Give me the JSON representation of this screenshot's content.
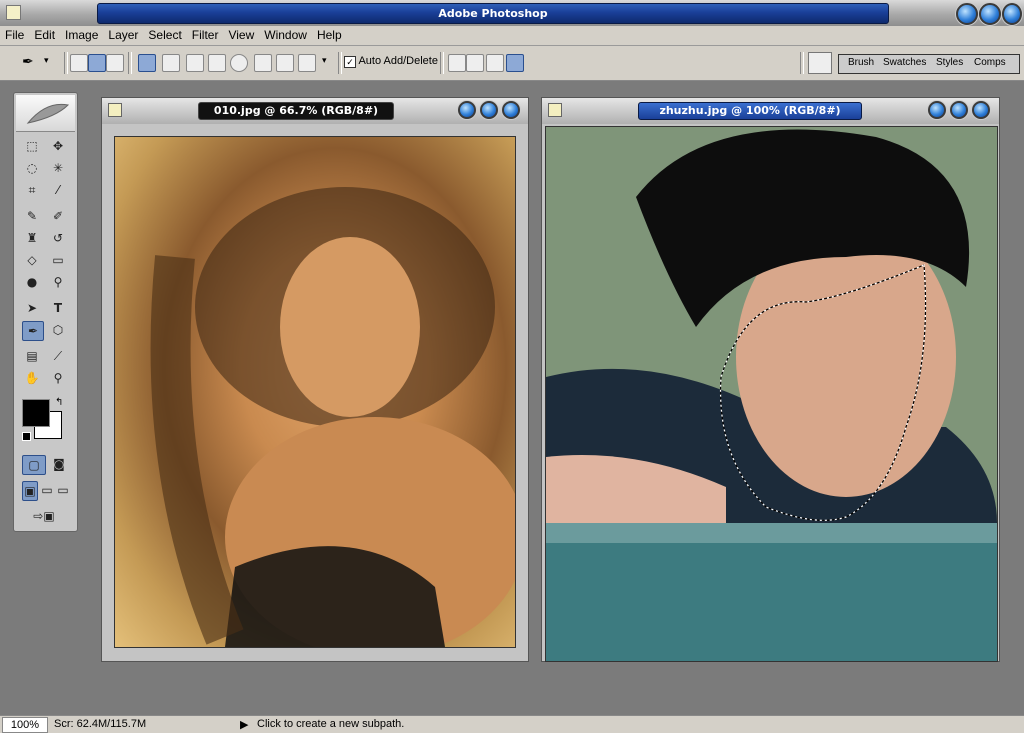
{
  "app": {
    "title": "Adobe Photoshop"
  },
  "menu": [
    "File",
    "Edit",
    "Image",
    "Layer",
    "Select",
    "Filter",
    "View",
    "Window",
    "Help"
  ],
  "options_bar": {
    "auto_add_delete_label": "Auto Add/Delete",
    "auto_add_delete_checked": true,
    "palette_tabs": [
      "Brush",
      "Swatches",
      "Styles",
      "Comps"
    ]
  },
  "documents": [
    {
      "title": "010.jpg @ 66.7% (RGB/8#)",
      "active": false
    },
    {
      "title": "zhuzhu.jpg @ 100% (RGB/8#)",
      "active": true
    }
  ],
  "status": {
    "zoom": "100%",
    "scratch": "Scr: 62.4M/115.7M",
    "hint": "Click to create a new subpath."
  },
  "colors": {
    "title_blue": "#1a3f98",
    "foreground": "#000000",
    "background": "#ffffff",
    "workspace": "#7b7b7b"
  },
  "icons": [
    "app-icon",
    "pen-tool-icon",
    "move-icon",
    "marquee-icon",
    "lasso-icon",
    "magic-wand-icon",
    "crop-icon",
    "slice-icon",
    "healing-brush-icon",
    "brush-icon",
    "clone-stamp-icon",
    "history-brush-icon",
    "eraser-icon",
    "gradient-icon",
    "blur-icon",
    "dodge-icon",
    "path-selection-icon",
    "type-icon",
    "custom-shape-icon",
    "notes-icon",
    "eyedropper-icon",
    "hand-icon",
    "zoom-icon",
    "quickmask-icon",
    "screen-mode-icon",
    "jump-to-imageready-icon"
  ]
}
